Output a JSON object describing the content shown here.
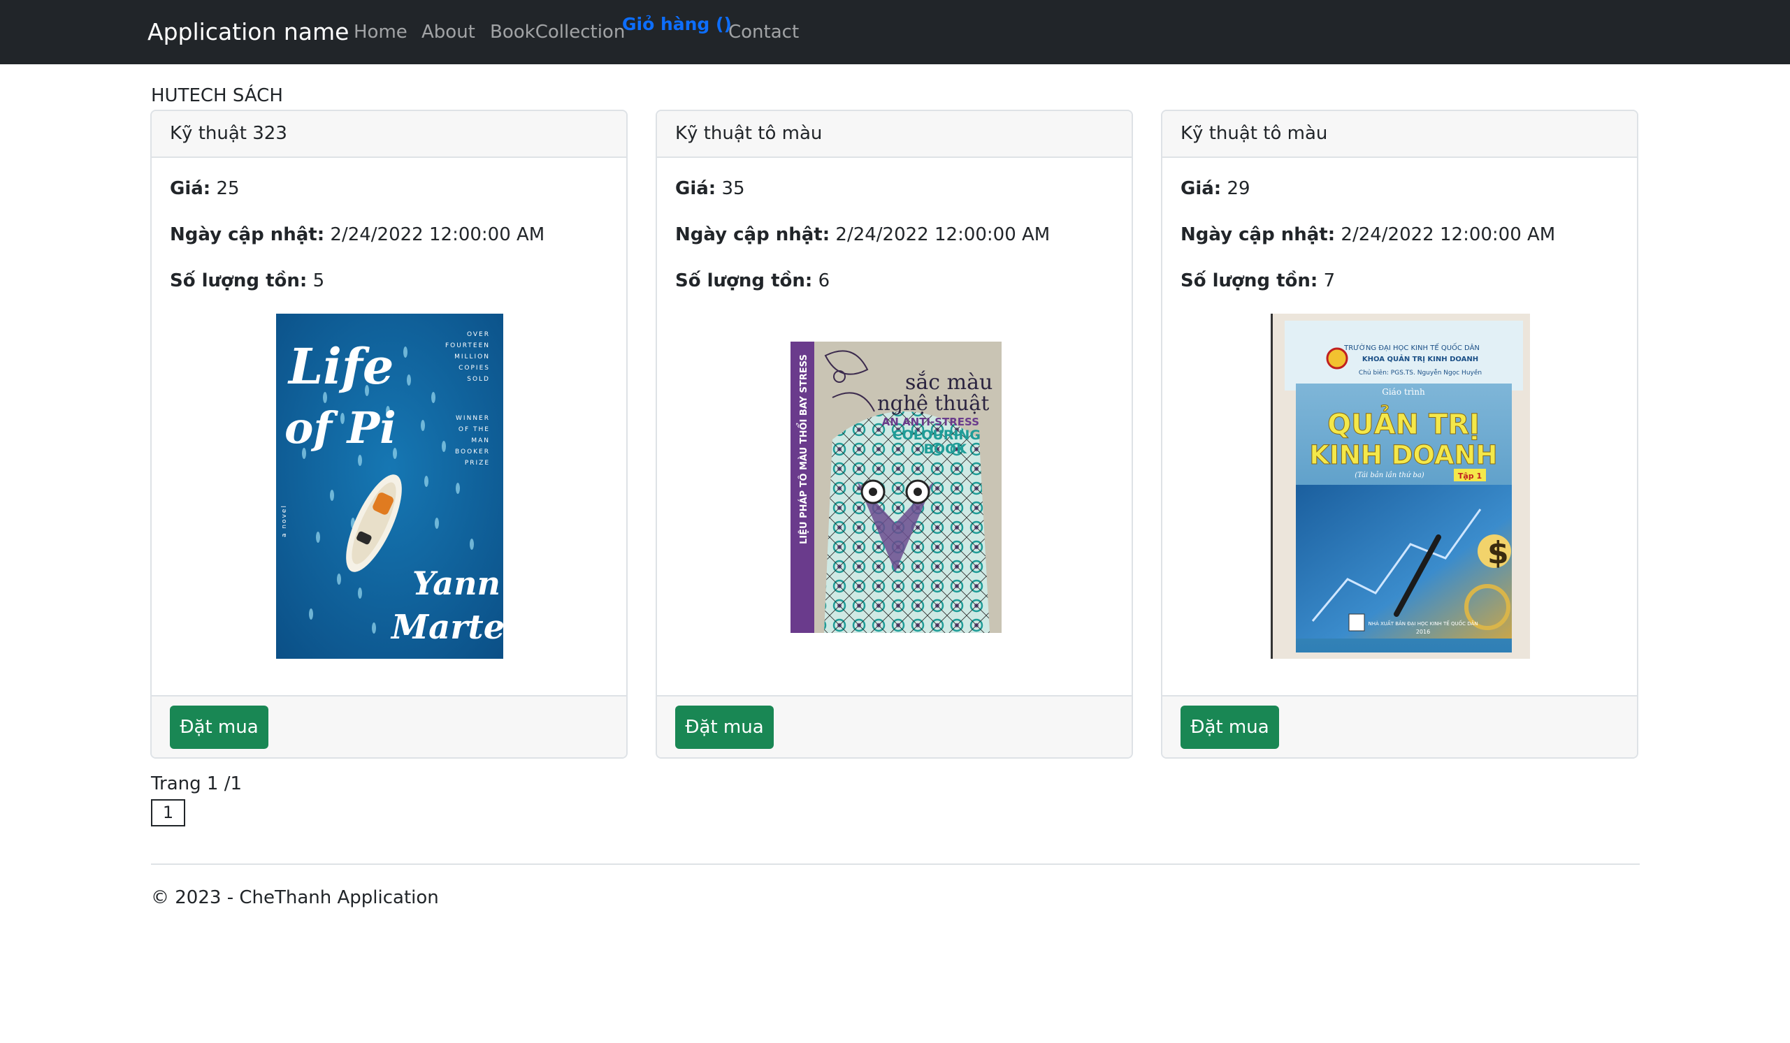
{
  "navbar": {
    "brand": "Application name",
    "links": [
      "Home",
      "About",
      "BookCollection"
    ],
    "cart_label": "Giỏ hàng ()",
    "contact": "Contact"
  },
  "page": {
    "heading": "HUTECH SÁCH"
  },
  "labels": {
    "price": "Giá:",
    "updated": "Ngày cập nhật:",
    "stock": "Số lượng tồn:",
    "buy": "Đặt mua"
  },
  "books": [
    {
      "title": "Kỹ thuật 323",
      "price": "25",
      "updated": "2/24/2022 12:00:00 AM",
      "stock": "5",
      "cover": {
        "kind": "novel-cover",
        "title_line1": "Life",
        "title_line2": "of Pi",
        "author_line1": "Yann",
        "author_line2": "Martel",
        "tagline": [
          "OVER",
          "FOURTEEN",
          "MILLION",
          "COPIES",
          "SOLD",
          "WINNER",
          "OF THE",
          "MAN",
          "BOOKER",
          "PRIZE"
        ],
        "side_text": "a novel"
      }
    },
    {
      "title": "Kỹ thuật tô màu",
      "price": "35",
      "updated": "2/24/2022 12:00:00 AM",
      "stock": "6",
      "cover": {
        "kind": "colouring-cover",
        "title_line1": "sắc màu",
        "title_line2": "nghệ thuật",
        "subtitle_line1": "AN ANTI-STRESS",
        "subtitle_line2": "COLOURING",
        "subtitle_line3": "BOOK",
        "spine": "LIỆU PHÁP TÔ MÀU THỔI BAY STRESS"
      }
    },
    {
      "title": "Kỹ thuật tô màu",
      "price": "29",
      "updated": "2/24/2022 12:00:00 AM",
      "stock": "7",
      "cover": {
        "kind": "textbook-cover",
        "school": "TRƯỜNG ĐẠI HỌC KINH TẾ QUỐC DÂN",
        "faculty": "KHOA QUẢN TRỊ KINH DOANH",
        "editor": "Chủ biên: PGS.TS. Nguyễn Ngọc Huyền",
        "label": "Giáo trình",
        "title_line1": "QUẢN TRỊ",
        "title_line2": "KINH DOANH",
        "edition": "(Tái bản lần thứ ba)",
        "volume": "Tập 1",
        "publisher": "NHÀ XUẤT BẢN ĐẠI HỌC KINH TẾ QUỐC DÂN",
        "year": "2016"
      }
    }
  ],
  "pagination": {
    "text": "Trang 1 /1",
    "current": "1"
  },
  "footer": {
    "text": "© 2023 - CheThanh Application"
  },
  "colors": {
    "navbar": "#212529",
    "cart": "#0d6efd",
    "buy_button": "#198754"
  }
}
